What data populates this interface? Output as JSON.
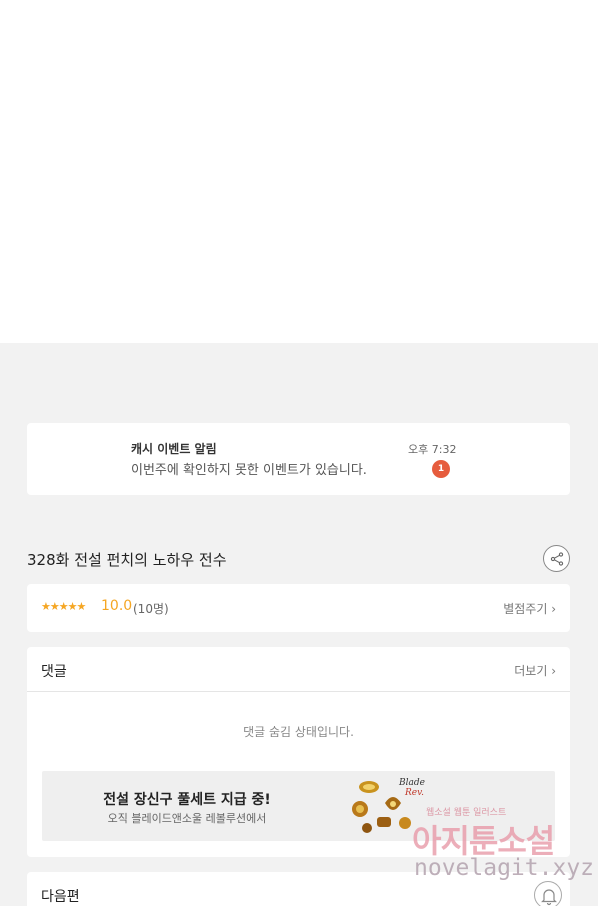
{
  "notice": {
    "title": "캐시 이벤트 알림",
    "time": "오후 7:32",
    "message": "이번주에 확인하지 못한 이벤트가 있습니다.",
    "badge": "1"
  },
  "episode": {
    "title": "328화 전설 펀치의 노하우 전수",
    "share_icon": "share-icon"
  },
  "rating": {
    "stars": "★★★★★",
    "score": "10.0",
    "count": "(10명)",
    "rate_link": "별점주기 ›"
  },
  "comments": {
    "title": "댓글",
    "more": "더보기 ›",
    "hidden_message": "댓글 숨김 상태입니다."
  },
  "banner": {
    "title": "전설 장신구 풀세트 지급 중!",
    "subtitle": "오직 블레이드앤소울 레볼루션에서"
  },
  "next": {
    "label": "다음편",
    "bell_icon": "bell-icon"
  },
  "watermark": {
    "top": "웹소설 웹툰 일러스트",
    "main": "아지툰소설",
    "url": "novelagit.xyz"
  },
  "colors": {
    "accent": "#f5a623",
    "badge": "#e65c3d",
    "background": "#f2f2f2"
  }
}
